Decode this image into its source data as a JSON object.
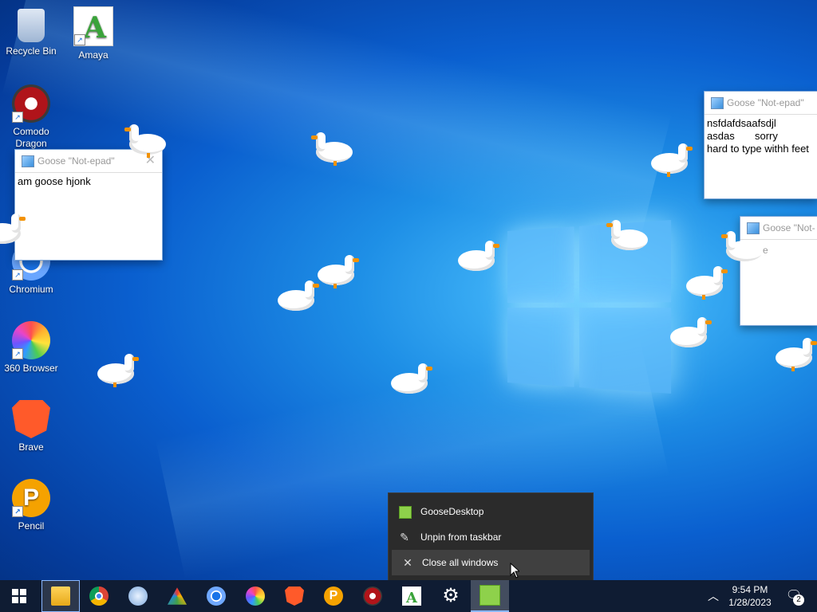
{
  "desktop_icons": [
    {
      "label": "Recycle Bin",
      "icon": "recycle-bin-icon"
    },
    {
      "label": "Amaya",
      "icon": "amaya-icon"
    },
    {
      "label": "Comodo\nDragon",
      "icon": "comodo-dragon-icon"
    },
    {
      "label": "Chromium",
      "icon": "chromium-icon"
    },
    {
      "label": "360 Browser",
      "icon": "360-browser-icon"
    },
    {
      "label": "Brave",
      "icon": "brave-icon"
    },
    {
      "label": "Pencil",
      "icon": "pencil-icon"
    }
  ],
  "notepads": [
    {
      "title": "Goose \"Not-epad\"",
      "text": "am goose hjonk"
    },
    {
      "title": "Goose \"Not-epad\"",
      "text": "nsfdafdsaafsdjl\nasdas       sorry\nhard to type withh feet"
    },
    {
      "title": "Goose \"Not-e",
      "text": ""
    }
  ],
  "context_menu": {
    "app_name": "GooseDesktop",
    "unpin": "Unpin from taskbar",
    "close_all": "Close all windows"
  },
  "taskbar": {
    "apps": [
      "start-button",
      "file-explorer",
      "chrome",
      "safari",
      "arch",
      "chromium",
      "360-browser",
      "brave",
      "pencil",
      "comodo-dragon",
      "amaya",
      "settings",
      "goose-desktop"
    ],
    "time": "9:54 PM",
    "date": "1/28/2023",
    "notification_count": "2"
  },
  "colors": {
    "taskbar": "#0f1c33",
    "desktop_accent": "#1e8fe6",
    "menu_bg": "#2b2b2b"
  }
}
